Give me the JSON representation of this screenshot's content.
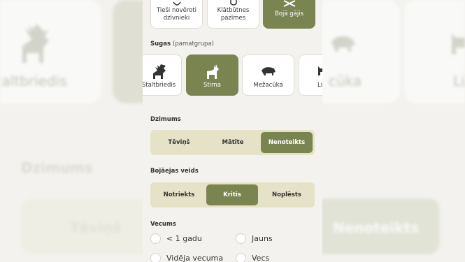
{
  "background": {
    "animal_left": "Staltbriedis",
    "animal_right_a": "cūka",
    "animal_right_b": "Lū",
    "section": "Dzimums",
    "option_left": "Tēviņš",
    "option_right": "Nenoteikts"
  },
  "observation_types": [
    {
      "label": "Tieši novēroti dzīvnieki",
      "icon": "eye-icon",
      "selected": false
    },
    {
      "label": "Klātbūtnes pazīmes",
      "icon": "footprint-icon",
      "selected": false
    },
    {
      "label": "Bojā gājis",
      "icon": "bone-icon",
      "selected": true
    }
  ],
  "species": {
    "title": "Sugas",
    "subtitle": "(pamatgrupa)",
    "items": [
      {
        "label": "Staltbriedis",
        "icon": "red-deer-icon",
        "selected": false
      },
      {
        "label": "Stirna",
        "icon": "roe-deer-icon",
        "selected": true
      },
      {
        "label": "Mežacūka",
        "icon": "wild-boar-icon",
        "selected": false
      },
      {
        "label": "Lū",
        "icon": "lynx-icon",
        "selected": false
      }
    ]
  },
  "gender": {
    "title": "Dzimums",
    "options": [
      "Tēviņš",
      "Mātīte",
      "Nenoteikts"
    ],
    "selected": "Nenoteikts"
  },
  "death_type": {
    "title": "Bojāejas veids",
    "options": [
      "Notriekts",
      "Kritis",
      "Noplēsts"
    ],
    "selected": "Kritis"
  },
  "age": {
    "title": "Vecums",
    "options": [
      "< 1 gadu",
      "Jauns",
      "Vidēja vecuma",
      "Vecs"
    ]
  },
  "colors": {
    "accent": "#7a8450",
    "segment_bg": "#e6e2c7",
    "page_bg": "#f3f2ee"
  }
}
